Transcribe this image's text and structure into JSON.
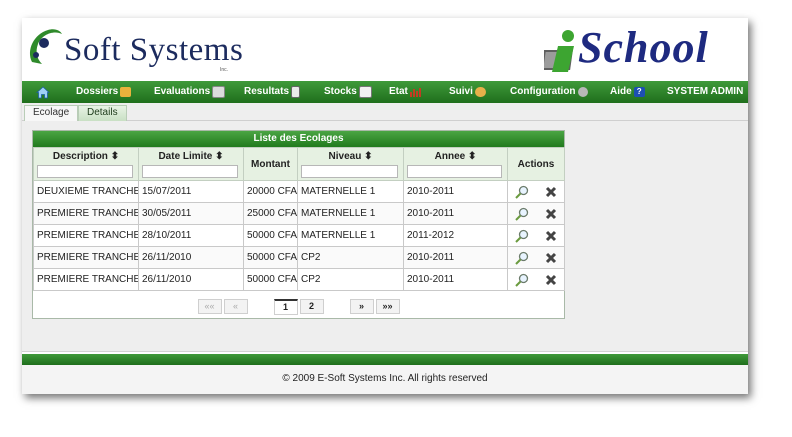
{
  "header": {
    "brand_left": "Soft Systems",
    "brand_left_inc": "Inc.",
    "brand_right": "School",
    "brand_right_letter": "i"
  },
  "nav": {
    "items": [
      {
        "label": "Dossiers",
        "icon": "folder-icon"
      },
      {
        "label": "Evaluations",
        "icon": "pencil-icon"
      },
      {
        "label": "Resultats",
        "icon": "document-icon"
      },
      {
        "label": "Stocks",
        "icon": "envelope-icon"
      },
      {
        "label": "Etat",
        "icon": "bar-chart-icon"
      },
      {
        "label": "Suivi",
        "icon": "users-icon"
      },
      {
        "label": "Configuration",
        "icon": "gear-icon"
      },
      {
        "label": "Aide",
        "icon": "help-icon"
      }
    ],
    "user": "SYSTEM ADMIN"
  },
  "tabs": [
    "Ecolage",
    "Details"
  ],
  "table": {
    "title": "Liste des Ecolages",
    "columns": [
      "Description",
      "Date Limite",
      "Montant",
      "Niveau",
      "Annee",
      "Actions"
    ],
    "rows": [
      [
        "DEUXIEME TRANCHE",
        "15/07/2011",
        "20000 CFA",
        "MATERNELLE 1",
        "2010-2011"
      ],
      [
        "PREMIERE TRANCHE",
        "30/05/2011",
        "25000 CFA",
        "MATERNELLE 1",
        "2010-2011"
      ],
      [
        "PREMIERE TRANCHE",
        "28/10/2011",
        "50000 CFA",
        "MATERNELLE 1",
        "2011-2012"
      ],
      [
        "PREMIERE TRANCHE",
        "26/11/2010",
        "50000 CFA",
        "CP2",
        "2010-2011"
      ],
      [
        "PREMIERE TRANCHE",
        "26/11/2010",
        "50000 CFA",
        "CP2",
        "2010-2011"
      ]
    ]
  },
  "pager": {
    "first": "««",
    "prev": "«",
    "pages": [
      "1",
      "2"
    ],
    "next": "»",
    "last": "»»"
  },
  "footer": "© 2009 E-Soft Systems Inc. All rights reserved",
  "colors": {
    "nav_green": "#2d8529",
    "brand_blue": "#1e2a80"
  }
}
